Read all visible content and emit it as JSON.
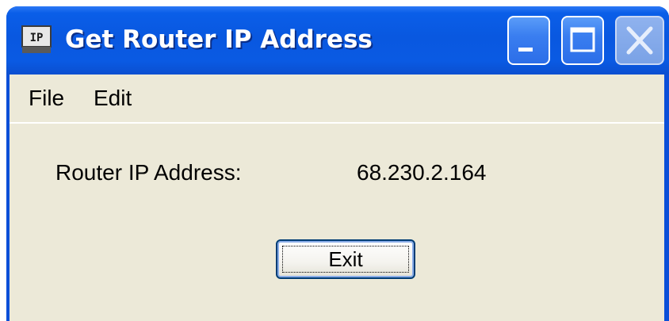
{
  "window": {
    "title": "Get Router IP Address",
    "icon": "ip-app-icon",
    "title_buttons": [
      "minimize-icon",
      "maximize-icon",
      "close-icon"
    ]
  },
  "menu": {
    "items": [
      {
        "label": "File"
      },
      {
        "label": "Edit"
      }
    ]
  },
  "content": {
    "ip_label": "Router IP Address:",
    "ip_value": "68.230.2.164",
    "exit_label": "Exit"
  },
  "colors": {
    "titlebar": "#0958e0",
    "client_bg": "#ece9d8",
    "button_border": "#003c74"
  }
}
